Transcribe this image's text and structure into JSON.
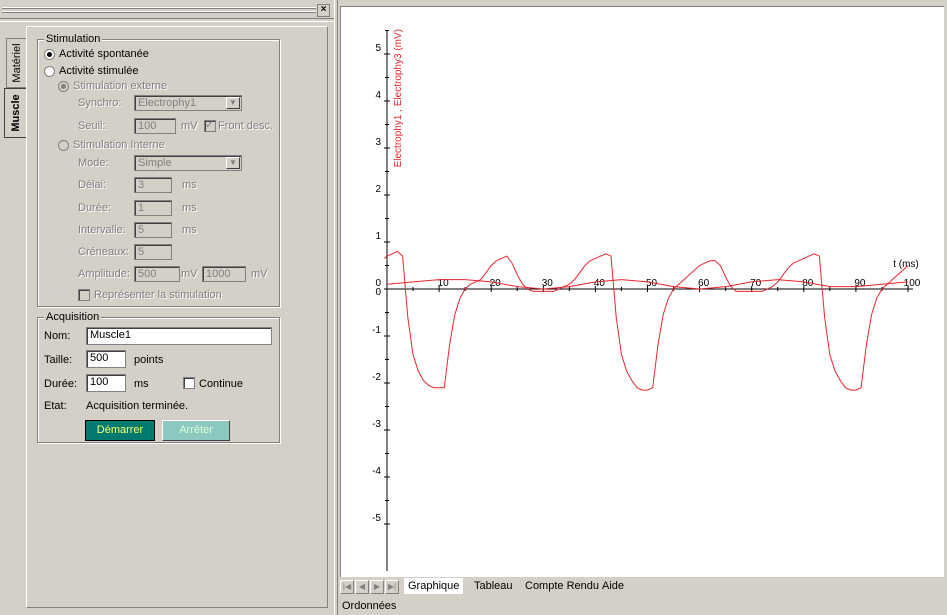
{
  "left_panel": {
    "vertical_tabs": [
      {
        "label": "Matériel"
      },
      {
        "label": "Muscle",
        "active": true
      }
    ],
    "close_icon": "close-x-icon",
    "stimulation": {
      "group_label": "Stimulation",
      "spontaneous_label": "Activité spontanée",
      "stimulated_label": "Activité stimulée",
      "selected": "spontaneous",
      "external": {
        "label": "Stimulation externe",
        "synchro_label": "Synchro:",
        "synchro_value": "Electrophy1",
        "seuil_label": "Seuil:",
        "seuil_value": "100",
        "seuil_unit": "mV",
        "front_desc_label": "Front desc.",
        "front_desc_checked": true
      },
      "internal": {
        "label": "Stimulation Interne",
        "mode_label": "Mode:",
        "mode_value": "Simple",
        "delai_label": "Délai:",
        "delai_value": "3",
        "delai_unit": "ms",
        "duree_label": "Durée:",
        "duree_value": "1",
        "duree_unit": "ms",
        "intervalle_label": "Intervalle:",
        "intervalle_value": "5",
        "intervalle_unit": "ms",
        "creneaux_label": "Créneaux:",
        "creneaux_value": "5",
        "amplitude_label": "Amplitude:",
        "amplitude_value1": "500",
        "amplitude_unit1": "mV",
        "amplitude_value2": "1000",
        "amplitude_unit2": "mV"
      },
      "represent_label": "Représenter la stimulation"
    },
    "acquisition": {
      "group_label": "Acquisition",
      "nom_label": "Nom:",
      "nom_value": "Muscle1",
      "taille_label": "Taille:",
      "taille_value": "500",
      "taille_unit": "points",
      "duree_label": "Durée:",
      "duree_value": "100",
      "duree_unit": "ms",
      "continue_label": "Continue",
      "etat_label": "Etat:",
      "etat_value": "Acquisition terminée.",
      "start_label": "Démarrer",
      "stop_label": "Arrêter"
    }
  },
  "bottom_tabs": [
    {
      "label": "Graphique",
      "active": true
    },
    {
      "label": "Tableau"
    },
    {
      "label": "Compte Rendu"
    },
    {
      "label": "Aide"
    }
  ],
  "status_text": "Ordonnées",
  "colors": {
    "trace": "#e8262e",
    "start_button": "#007a6e",
    "stop_button": "#8cc8c0"
  },
  "chart_data": {
    "type": "line",
    "ylabel": "Electrophy1 , Electrophy3 (mV)",
    "xlabel": "t (ms)",
    "xlim": [
      0,
      100
    ],
    "ylim": [
      -6,
      5.5
    ],
    "x_ticks": [
      "10",
      "20",
      "30",
      "40",
      "50",
      "60",
      "70",
      "80",
      "90",
      "100"
    ],
    "y_ticks": [
      "5",
      "4",
      "3",
      "2",
      "1",
      "0",
      "-1",
      "-2",
      "-3",
      "-4",
      "-5"
    ],
    "series": [
      {
        "name": "Electrophy1",
        "x": [
          -0.5,
          0,
          1,
          2,
          3,
          4,
          5,
          6,
          7,
          8,
          9,
          10,
          11,
          12,
          13,
          14,
          15,
          16,
          17,
          18,
          19,
          20,
          21,
          22,
          23,
          24,
          25,
          26,
          27,
          28,
          29,
          30,
          31,
          32,
          33,
          34,
          35,
          36,
          37,
          38,
          39,
          40,
          41,
          42,
          43,
          44,
          45,
          46,
          47,
          48,
          49,
          50,
          51,
          52,
          53,
          54,
          55,
          56,
          57,
          58,
          59,
          60,
          61,
          62,
          63,
          64,
          65,
          66,
          67,
          68,
          69,
          70,
          71,
          72,
          73,
          74,
          75,
          76,
          77,
          78,
          79,
          80,
          81,
          82,
          83,
          84,
          85,
          86,
          87,
          88,
          89,
          90,
          91,
          92,
          93,
          94,
          95,
          96,
          97,
          98,
          99,
          100
        ],
        "y": [
          0.65,
          0.7,
          0.75,
          0.8,
          0.7,
          -0.6,
          -1.4,
          -1.75,
          -1.95,
          -2.05,
          -2.1,
          -2.1,
          -2.1,
          -1.2,
          -0.55,
          -0.2,
          0,
          0.1,
          0.15,
          0.2,
          0.35,
          0.5,
          0.6,
          0.65,
          0.7,
          0.55,
          0.3,
          0.1,
          0,
          -0.05,
          -0.05,
          -0.05,
          -0.05,
          -0.05,
          0,
          0.05,
          0.1,
          0.2,
          0.35,
          0.5,
          0.6,
          0.65,
          0.7,
          0.75,
          0.7,
          -0.6,
          -1.4,
          -1.75,
          -1.95,
          -2.1,
          -2.15,
          -2.15,
          -2.1,
          -1.2,
          -0.55,
          -0.2,
          0,
          0.1,
          0.2,
          0.3,
          0.4,
          0.5,
          0.55,
          0.6,
          0.6,
          0.5,
          0.25,
          0.05,
          -0.05,
          -0.05,
          -0.05,
          -0.05,
          -0.05,
          -0.05,
          0,
          0.05,
          0.15,
          0.3,
          0.45,
          0.55,
          0.6,
          0.65,
          0.7,
          0.75,
          0.7,
          -0.6,
          -1.4,
          -1.75,
          -1.95,
          -2.1,
          -2.15,
          -2.15,
          -2.1,
          -1.2,
          -0.55,
          -0.2,
          0,
          0.1,
          0.2,
          0.3,
          0.4,
          0.5
        ]
      },
      {
        "name": "Electrophy3",
        "x": [
          0,
          5,
          10,
          15,
          20,
          25,
          30,
          35,
          40,
          45,
          50,
          55,
          60,
          65,
          70,
          75,
          80,
          85,
          90,
          95,
          100
        ],
        "y": [
          0.1,
          0.15,
          0.2,
          0.2,
          0.15,
          0.05,
          0,
          0.05,
          0.15,
          0.2,
          0.15,
          0.05,
          0,
          0.05,
          0.15,
          0.2,
          0.15,
          0.05,
          0.05,
          0.1,
          0.15
        ]
      }
    ]
  }
}
